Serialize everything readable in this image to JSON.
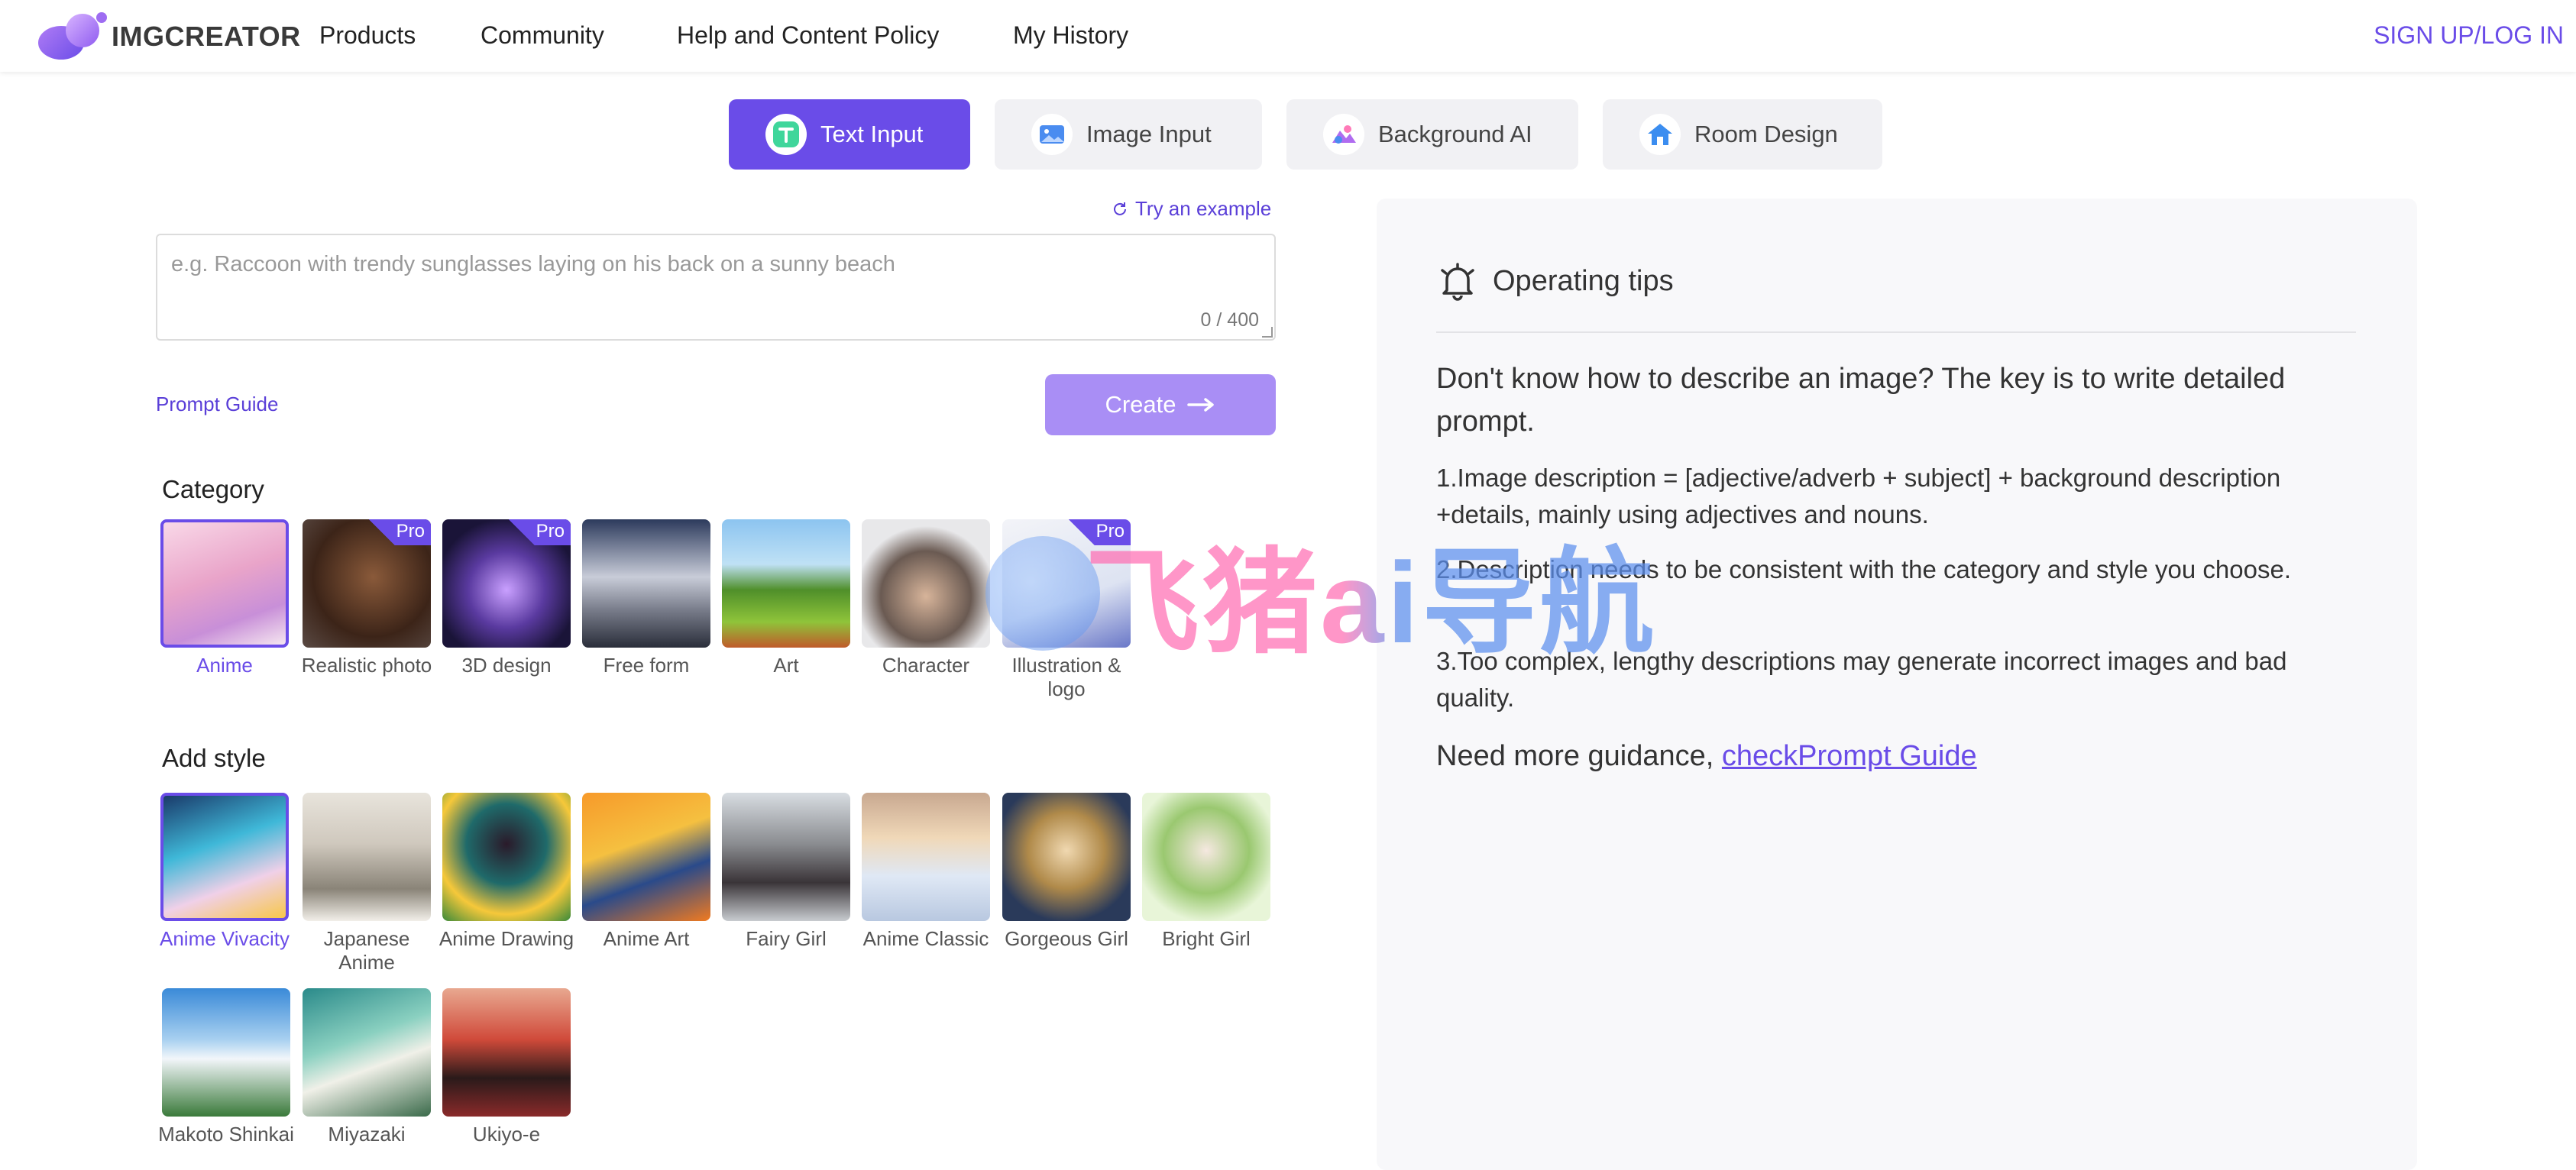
{
  "nav": {
    "logo_text": "IMGCREATOR",
    "items": [
      "Products",
      "Community",
      "Help and Content Policy",
      "My History"
    ],
    "signup": "SIGN UP/LOG IN"
  },
  "tabs": [
    {
      "label": "Text Input",
      "active": true
    },
    {
      "label": "Image Input",
      "active": false
    },
    {
      "label": "Background AI",
      "active": false
    },
    {
      "label": "Room Design",
      "active": false
    }
  ],
  "editor": {
    "try_example": "Try an example",
    "placeholder": "e.g. Raccoon with trendy sunglasses laying on his back on a sunny beach",
    "value": "",
    "counter": "0 / 400",
    "prompt_guide": "Prompt Guide",
    "create": "Create"
  },
  "category": {
    "title": "Category",
    "items": [
      {
        "label": "Anime",
        "selected": true,
        "pro": false
      },
      {
        "label": "Realistic photo",
        "selected": false,
        "pro": true
      },
      {
        "label": "3D design",
        "selected": false,
        "pro": true
      },
      {
        "label": "Free form",
        "selected": false,
        "pro": false
      },
      {
        "label": "Art",
        "selected": false,
        "pro": false
      },
      {
        "label": "Character",
        "selected": false,
        "pro": false
      },
      {
        "label": "Illustration & logo",
        "selected": false,
        "pro": true
      }
    ],
    "pro_label": "Pro"
  },
  "style": {
    "title": "Add style",
    "items": [
      {
        "label": "Anime Vivacity",
        "selected": true
      },
      {
        "label": "Japanese Anime",
        "selected": false
      },
      {
        "label": "Anime Drawing",
        "selected": false
      },
      {
        "label": "Anime Art",
        "selected": false
      },
      {
        "label": "Fairy Girl",
        "selected": false
      },
      {
        "label": "Anime Classic",
        "selected": false
      },
      {
        "label": "Gorgeous Girl",
        "selected": false
      },
      {
        "label": "Bright Girl",
        "selected": false
      },
      {
        "label": "Makoto Shinkai",
        "selected": false
      },
      {
        "label": "Miyazaki",
        "selected": false
      },
      {
        "label": "Ukiyo-e",
        "selected": false
      }
    ]
  },
  "tips": {
    "title": "Operating tips",
    "intro": "Don't know how to describe an image? The key is to write detailed prompt.",
    "t1": "1.Image description = [adjective/adverb + subject] + background description +details, mainly using adjectives and nouns.",
    "t2": "2.Description needs to be consistent with the category and style you choose.",
    "t3": "3.Too complex, lengthy descriptions may generate incorrect images and bad quality.",
    "more_prefix": "Need more guidance, ",
    "more_link": "checkPrompt Guide"
  },
  "watermark": "飞猪ai导航",
  "colors": {
    "accent": "#6a4ce8",
    "create_btn": "#a98ef5",
    "tab_bg": "#f1f1f4",
    "tips_bg": "#f8f8fa"
  }
}
